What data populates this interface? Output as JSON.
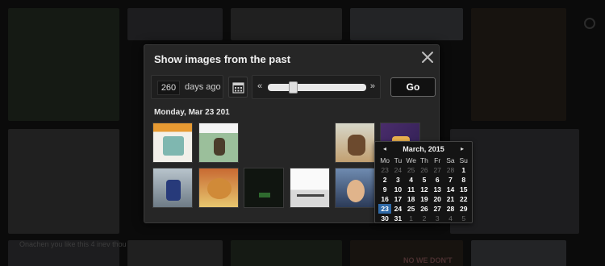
{
  "modal": {
    "title": "Show images from the past",
    "days_value": "260",
    "days_label": "days ago",
    "slider_prev": "«",
    "slider_next": "»",
    "slider_value": 0.23,
    "go_label": "Go",
    "date_heading": "Monday, Mar 23 201"
  },
  "calendar": {
    "month_label": "March, 2015",
    "prev": "◂",
    "next": "▸",
    "weekdays": [
      "Mo",
      "Tu",
      "We",
      "Th",
      "Fr",
      "Sa",
      "Su"
    ],
    "weeks": [
      [
        {
          "d": "23",
          "m": true
        },
        {
          "d": "24",
          "m": true
        },
        {
          "d": "25",
          "m": true
        },
        {
          "d": "26",
          "m": true
        },
        {
          "d": "27",
          "m": true
        },
        {
          "d": "28",
          "m": true
        },
        {
          "d": "1",
          "m": false
        }
      ],
      [
        {
          "d": "2",
          "m": false
        },
        {
          "d": "3",
          "m": false
        },
        {
          "d": "4",
          "m": false
        },
        {
          "d": "5",
          "m": false
        },
        {
          "d": "6",
          "m": false
        },
        {
          "d": "7",
          "m": false
        },
        {
          "d": "8",
          "m": false
        }
      ],
      [
        {
          "d": "9",
          "m": false
        },
        {
          "d": "10",
          "m": false
        },
        {
          "d": "11",
          "m": false
        },
        {
          "d": "12",
          "m": false
        },
        {
          "d": "13",
          "m": false
        },
        {
          "d": "14",
          "m": false
        },
        {
          "d": "15",
          "m": false
        }
      ],
      [
        {
          "d": "16",
          "m": false
        },
        {
          "d": "17",
          "m": false
        },
        {
          "d": "18",
          "m": false
        },
        {
          "d": "19",
          "m": false
        },
        {
          "d": "20",
          "m": false
        },
        {
          "d": "21",
          "m": false
        },
        {
          "d": "22",
          "m": false
        }
      ],
      [
        {
          "d": "23",
          "m": false,
          "sel": true
        },
        {
          "d": "24",
          "m": false
        },
        {
          "d": "25",
          "m": false
        },
        {
          "d": "26",
          "m": false
        },
        {
          "d": "27",
          "m": false
        },
        {
          "d": "28",
          "m": false
        },
        {
          "d": "29",
          "m": false
        }
      ],
      [
        {
          "d": "30",
          "m": false
        },
        {
          "d": "31",
          "m": false
        },
        {
          "d": "1",
          "m": true
        },
        {
          "d": "2",
          "m": true
        },
        {
          "d": "3",
          "m": true
        },
        {
          "d": "4",
          "m": true
        },
        {
          "d": "5",
          "m": true
        }
      ]
    ]
  },
  "background": {
    "bottom_text": "Onachen you like this 4 inev thou",
    "bottom_text2": "NO WE DON'T"
  },
  "icons": {
    "close": "close-icon",
    "calendar": "calendar-icon"
  }
}
